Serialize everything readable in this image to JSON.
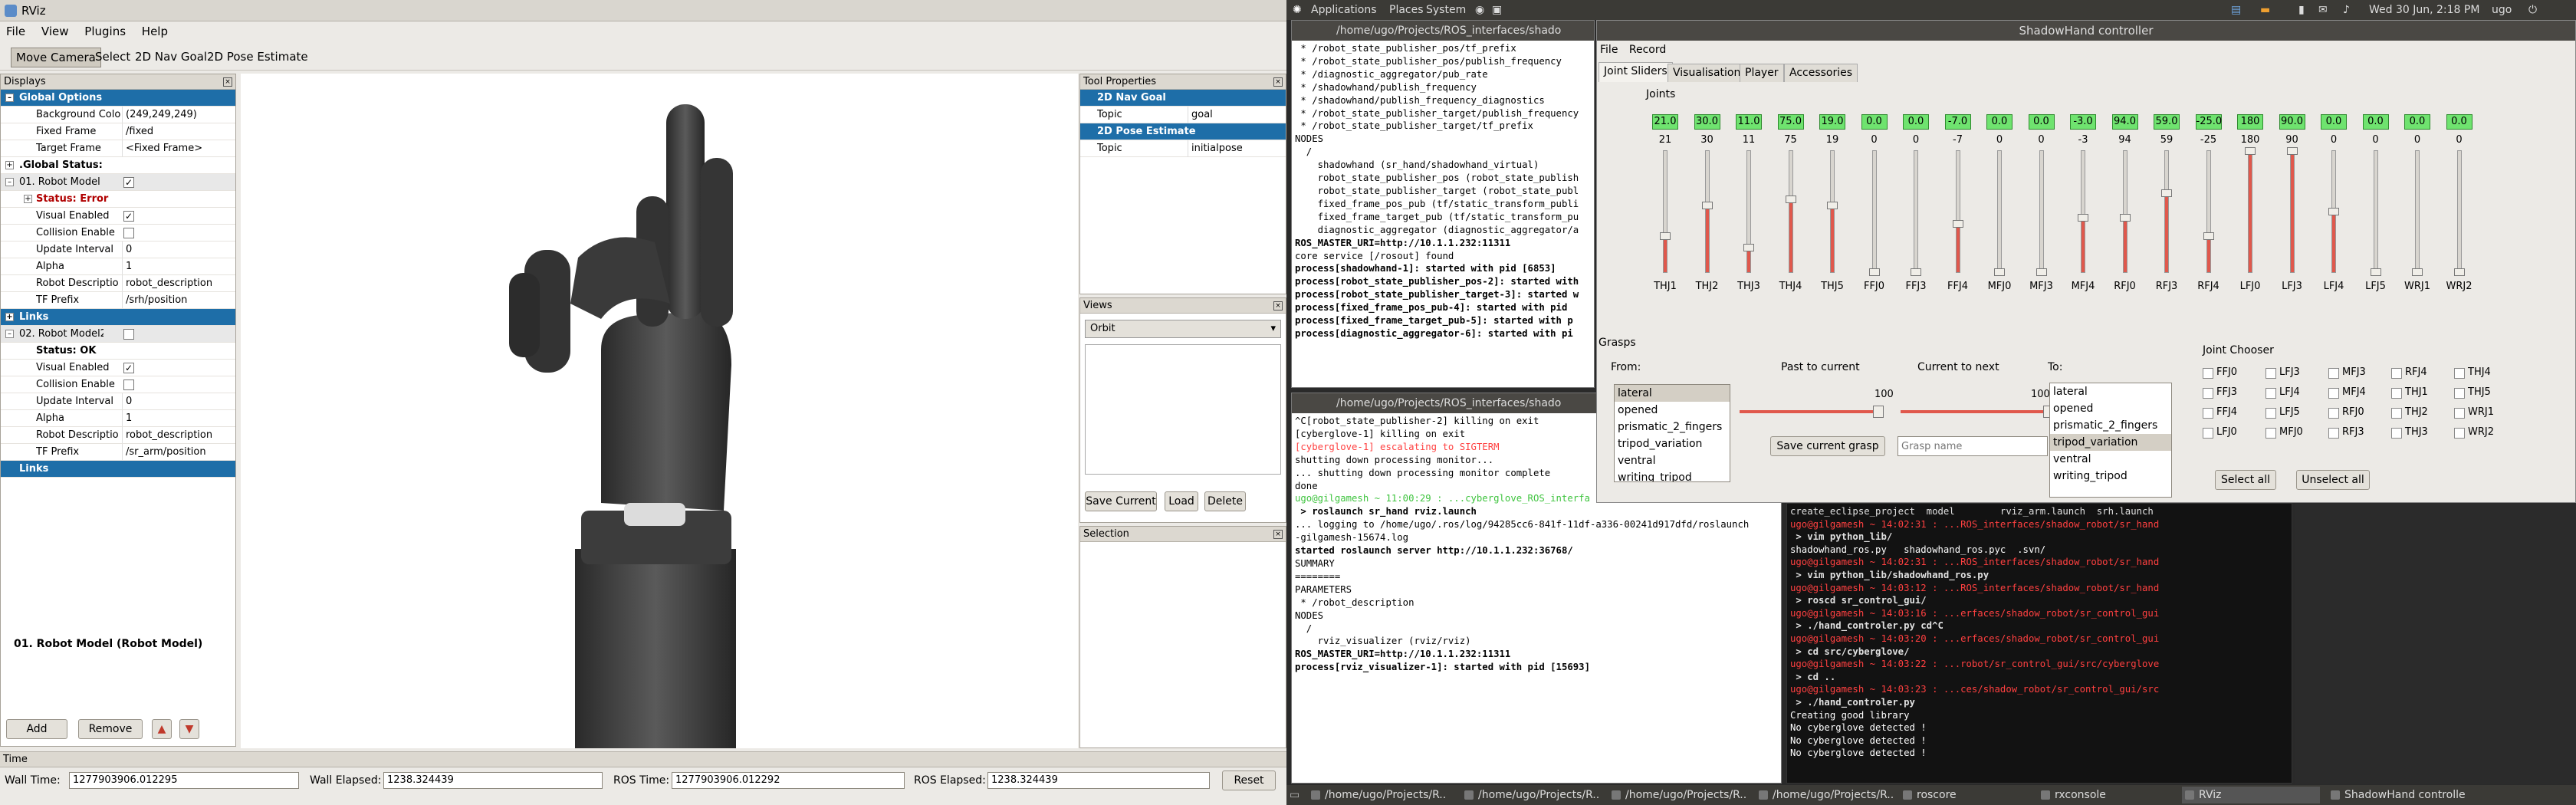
{
  "rviz": {
    "title": "RViz",
    "menu": [
      "File",
      "View",
      "Plugins",
      "Help"
    ],
    "tools": [
      "Move Camera",
      "Select",
      "2D Nav Goal",
      "2D Pose Estimate"
    ],
    "displays_title": "Displays",
    "displays": [
      {
        "kind": "hdr",
        "key": "Global Options",
        "exp": "–"
      },
      {
        "key": "Background Color",
        "val": "(249,249,249)"
      },
      {
        "key": "Fixed Frame",
        "val": "/fixed"
      },
      {
        "key": "Target Frame",
        "val": "<Fixed Frame>"
      },
      {
        "kind": "plain",
        "key": ".Global Status: OK",
        "exp": "+"
      },
      {
        "kind": "sub",
        "key": "01. Robot Model (R",
        "check": "✓",
        "exp": "–"
      },
      {
        "kind": "err",
        "key": "Status: Error",
        "exp": "+"
      },
      {
        "key": "Visual Enabled",
        "check": "✓"
      },
      {
        "key": "Collision Enable",
        "check": ""
      },
      {
        "key": "Update Interval",
        "val": "0"
      },
      {
        "key": "Alpha",
        "val": "1"
      },
      {
        "key": "Robot Descriptio",
        "val": "robot_description"
      },
      {
        "key": "TF Prefix",
        "val": "/srh/position"
      },
      {
        "kind": "hdr",
        "key": "Links",
        "exp": "+"
      },
      {
        "kind": "sub",
        "key": "02. Robot Model2 (",
        "check": "",
        "exp": "–"
      },
      {
        "kind": "bold",
        "key": "Status: OK"
      },
      {
        "key": "Visual Enabled",
        "check": "✓"
      },
      {
        "key": "Collision Enable",
        "check": ""
      },
      {
        "key": "Update Interval",
        "val": "0"
      },
      {
        "key": "Alpha",
        "val": "1"
      },
      {
        "key": "Robot Descriptio",
        "val": "robot_description"
      },
      {
        "key": "TF Prefix",
        "val": "/sr_arm/position"
      },
      {
        "kind": "hdr",
        "key": "Links"
      }
    ],
    "display_desc": "01. Robot Model (Robot Model)",
    "buttons": {
      "add": "Add",
      "remove": "Remove"
    },
    "tool_props_title": "Tool Properties",
    "tool_props": [
      {
        "hdr": "2D Nav Goal"
      },
      {
        "key": "Topic",
        "val": "goal"
      },
      {
        "hdr": "2D Pose Estimate"
      },
      {
        "key": "Topic",
        "val": "initialpose"
      }
    ],
    "views_title": "Views",
    "view_type": "Orbit",
    "views_buttons": {
      "save": "Save Current",
      "load": "Load",
      "delete": "Delete"
    },
    "selection_title": "Selection",
    "time_title": "Time",
    "time": {
      "wall_time_label": "Wall Time:",
      "wall_time": "1277903906.012295",
      "wall_elapsed_label": "Wall Elapsed:",
      "wall_elapsed": "1238.324439",
      "ros_time_label": "ROS Time:",
      "ros_time": "1277903906.012292",
      "ros_elapsed_label": "ROS Elapsed:",
      "ros_elapsed": "1238.324439",
      "reset": "Reset"
    }
  },
  "panel": {
    "menus": [
      "Applications",
      "Places",
      "System"
    ],
    "clock": "Wed 30 Jun, 2:18 PM",
    "user": "ugo"
  },
  "term1": {
    "title": "/home/ugo/Projects/ROS_interfaces/shado",
    "lines": [
      {
        "t": " * /robot_state_publisher_pos/tf_prefix"
      },
      {
        "t": " * /robot_state_publisher_pos/publish_frequency"
      },
      {
        "t": " * /diagnostic_aggregator/pub_rate"
      },
      {
        "t": " * /shadowhand/publish_frequency"
      },
      {
        "t": " * /shadowhand/publish_frequency_diagnostics"
      },
      {
        "t": " * /robot_state_publisher_target/publish_frequency"
      },
      {
        "t": " * /robot_state_publisher_target/tf_prefix"
      },
      {
        "t": ""
      },
      {
        "t": "NODES"
      },
      {
        "t": "  /"
      },
      {
        "t": "    shadowhand (sr_hand/shadowhand_virtual)"
      },
      {
        "t": "    robot_state_publisher_pos (robot_state_publish"
      },
      {
        "t": "    robot_state_publisher_target (robot_state_publ"
      },
      {
        "t": "    fixed_frame_pos_pub (tf/static_transform_publi"
      },
      {
        "t": "    fixed_frame_target_pub (tf/static_transform_pu"
      },
      {
        "t": "    diagnostic_aggregator (diagnostic_aggregator/a"
      },
      {
        "t": ""
      },
      {
        "t": "ROS_MASTER_URI=http://10.1.1.232:11311",
        "c": "ln-b"
      },
      {
        "t": ""
      },
      {
        "t": "core service [/rosout] found"
      },
      {
        "t": "process[shadowhand-1]: started with pid [6853]",
        "c": "ln-b"
      },
      {
        "t": "process[robot_state_publisher_pos-2]: started with",
        "c": "ln-b"
      },
      {
        "t": "process[robot_state_publisher_target-3]: started w",
        "c": "ln-b"
      },
      {
        "t": "process[fixed_frame_pos_pub-4]: started with pid",
        "c": "ln-b"
      },
      {
        "t": "process[fixed_frame_target_pub-5]: started with p",
        "c": "ln-b"
      },
      {
        "t": "process[diagnostic_aggregator-6]: started with pi",
        "c": "ln-b"
      }
    ]
  },
  "term2": {
    "title": "/home/ugo/Projects/ROS_interfaces/shado",
    "lines": [
      {
        "t": "^C[robot_state_publisher-2] killing on exit"
      },
      {
        "t": "[cyberglove-1] killing on exit"
      },
      {
        "t": "[cyberglove-1] escalating to SIGTERM",
        "c": "ln-r"
      },
      {
        "t": "shutting down processing monitor..."
      },
      {
        "t": "... shutting down processing monitor complete"
      },
      {
        "t": "done"
      },
      {
        "t": "ugo@gilgamesh ~ 11:00:29 : ...cyberglove_ROS_interfa",
        "c": "ln-g"
      },
      {
        "t": " > roslaunch sr_hand rviz.launch",
        "c": "ln-b"
      },
      {
        "t": "... logging to /home/ugo/.ros/log/94285cc6-841f-11df-a336-00241d917dfd/roslaunch"
      },
      {
        "t": "-gilgamesh-15674.log"
      },
      {
        "t": ""
      },
      {
        "t": "started roslaunch server http://10.1.1.232:36768/",
        "c": "ln-b"
      },
      {
        "t": ""
      },
      {
        "t": "SUMMARY"
      },
      {
        "t": "========"
      },
      {
        "t": ""
      },
      {
        "t": "PARAMETERS"
      },
      {
        "t": " * /robot_description"
      },
      {
        "t": ""
      },
      {
        "t": "NODES"
      },
      {
        "t": "  /"
      },
      {
        "t": "    rviz_visualizer (rviz/rviz)"
      },
      {
        "t": ""
      },
      {
        "t": "ROS_MASTER_URI=http://10.1.1.232:11311",
        "c": "ln-b"
      },
      {
        "t": ""
      },
      {
        "t": "process[rviz_visualizer-1]: started with pid [15693]",
        "c": "ln-b"
      }
    ]
  },
  "term3": {
    "lines": [
      {
        "t": "create_eclipse_project  model        rviz_arm.launch  srh.launch"
      },
      {
        "t": "ugo@gilgamesh ~ 14:02:31 : ...ROS_interfaces/shadow_robot/sr_hand",
        "c": "ln-r"
      },
      {
        "t": " > vim python_lib/",
        "c": "ln-b"
      },
      {
        "t": "shadowhand_ros.py   shadowhand_ros.pyc  .svn/",
        "c": "ln-w"
      },
      {
        "t": "ugo@gilgamesh ~ 14:02:31 : ...ROS_interfaces/shadow_robot/sr_hand",
        "c": "ln-r"
      },
      {
        "t": " > vim python_lib/shadowhand_ros.py",
        "c": "ln-b"
      },
      {
        "t": "ugo@gilgamesh ~ 14:03:12 : ...ROS_interfaces/shadow_robot/sr_hand",
        "c": "ln-r"
      },
      {
        "t": " > roscd sr_control_gui/",
        "c": "ln-b"
      },
      {
        "t": "ugo@gilgamesh ~ 14:03:16 : ...erfaces/shadow_robot/sr_control_gui",
        "c": "ln-r"
      },
      {
        "t": " > ./hand_controler.py cd^C",
        "c": "ln-b"
      },
      {
        "t": "ugo@gilgamesh ~ 14:03:20 : ...erfaces/shadow_robot/sr_control_gui",
        "c": "ln-r"
      },
      {
        "t": " > cd src/cyberglove/",
        "c": "ln-b"
      },
      {
        "t": "ugo@gilgamesh ~ 14:03:22 : ...robot/sr_control_gui/src/cyberglove",
        "c": "ln-r"
      },
      {
        "t": " > cd ..",
        "c": "ln-b"
      },
      {
        "t": "ugo@gilgamesh ~ 14:03:23 : ...ces/shadow_robot/sr_control_gui/src",
        "c": "ln-r"
      },
      {
        "t": " > ./hand_controler.py",
        "c": "ln-b"
      },
      {
        "t": "Creating good library",
        "c": "ln-w"
      },
      {
        "t": "No cyberglove detected !",
        "c": "ln-w"
      },
      {
        "t": "No cyberglove detected !",
        "c": "ln-w"
      },
      {
        "t": "No cyberglove detected !",
        "c": "ln-w"
      }
    ]
  },
  "shc": {
    "title": "ShadowHand controller",
    "menu": [
      "File",
      "Record"
    ],
    "tabs": [
      "Joint Sliders",
      "Visualisation",
      "Player",
      "Accessories"
    ],
    "joints_label": "Joints",
    "joints": [
      {
        "name": "THJ1",
        "val": "21.0",
        "num": "21",
        "f": 0.3
      },
      {
        "name": "THJ2",
        "val": "30.0",
        "num": "30",
        "f": 0.55
      },
      {
        "name": "THJ3",
        "val": "11.0",
        "num": "11",
        "f": 0.2
      },
      {
        "name": "THJ4",
        "val": "75.0",
        "num": "75",
        "f": 0.6
      },
      {
        "name": "THJ5",
        "val": "19.0",
        "num": "19",
        "f": 0.55
      },
      {
        "name": "FFJ0",
        "val": "0.0",
        "num": "0",
        "f": 0.0
      },
      {
        "name": "FFJ3",
        "val": "0.0",
        "num": "0",
        "f": 0.0
      },
      {
        "name": "FFJ4",
        "val": "-7.0",
        "num": "-7",
        "f": 0.4
      },
      {
        "name": "MFJ0",
        "val": "0.0",
        "num": "0",
        "f": 0.0
      },
      {
        "name": "MFJ3",
        "val": "0.0",
        "num": "0",
        "f": 0.0
      },
      {
        "name": "MFJ4",
        "val": "-3.0",
        "num": "-3",
        "f": 0.45
      },
      {
        "name": "RFJ0",
        "val": "94.0",
        "num": "94",
        "f": 0.45
      },
      {
        "name": "RFJ3",
        "val": "59.0",
        "num": "59",
        "f": 0.65
      },
      {
        "name": "RFJ4",
        "val": "-25.0",
        "num": "-25",
        "f": 0.3
      },
      {
        "name": "LFJ0",
        "val": "180",
        "num": "180",
        "f": 1.0
      },
      {
        "name": "LFJ3",
        "val": "90.0",
        "num": "90",
        "f": 1.0
      },
      {
        "name": "LFJ4",
        "val": "0.0",
        "num": "0",
        "f": 0.5
      },
      {
        "name": "LFJ5",
        "val": "0.0",
        "num": "0",
        "f": 0.0
      },
      {
        "name": "WRJ1",
        "val": "0.0",
        "num": "0",
        "f": 0.0
      },
      {
        "name": "WRJ2",
        "val": "0.0",
        "num": "0",
        "f": 0.0
      }
    ],
    "grasps_label": "Grasps",
    "from_label": "From:",
    "from_list": [
      "lateral",
      "opened",
      "prismatic_2_fingers",
      "tripod_variation",
      "ventral",
      "writing_tripod"
    ],
    "past_label": "Past to current",
    "past_value": "100",
    "next_label": "Current to next",
    "next_value": "100",
    "save_grasp": "Save current grasp",
    "grasp_name": "Grasp name",
    "to_label": "To:",
    "to_list": [
      "lateral",
      "opened",
      "prismatic_2_fingers",
      "tripod_variation",
      "ventral",
      "writing_tripod"
    ],
    "chooser_label": "Joint Chooser",
    "chooser": [
      "FFJ0",
      "FFJ3",
      "FFJ4",
      "LFJ0",
      "LFJ3",
      "LFJ4",
      "LFJ5",
      "MFJ0",
      "MFJ3",
      "MFJ4",
      "RFJ0",
      "RFJ3",
      "RFJ4",
      "THJ1",
      "THJ2",
      "THJ3",
      "THJ4",
      "THJ5",
      "WRJ1",
      "WRJ2"
    ],
    "select_all": "Select all",
    "unselect_all": "Unselect all"
  },
  "taskbar": [
    "/home/ugo/Projects/R...",
    "/home/ugo/Projects/R...",
    "/home/ugo/Projects/R...",
    "/home/ugo/Projects/R...",
    "roscore",
    "rxconsole",
    "RViz",
    "ShadowHand controller"
  ],
  "colors": {
    "accent": "#1e6ea8",
    "joint_value": "#6fe36f",
    "slider_fill": "#e0584c",
    "error": "#b00000"
  }
}
